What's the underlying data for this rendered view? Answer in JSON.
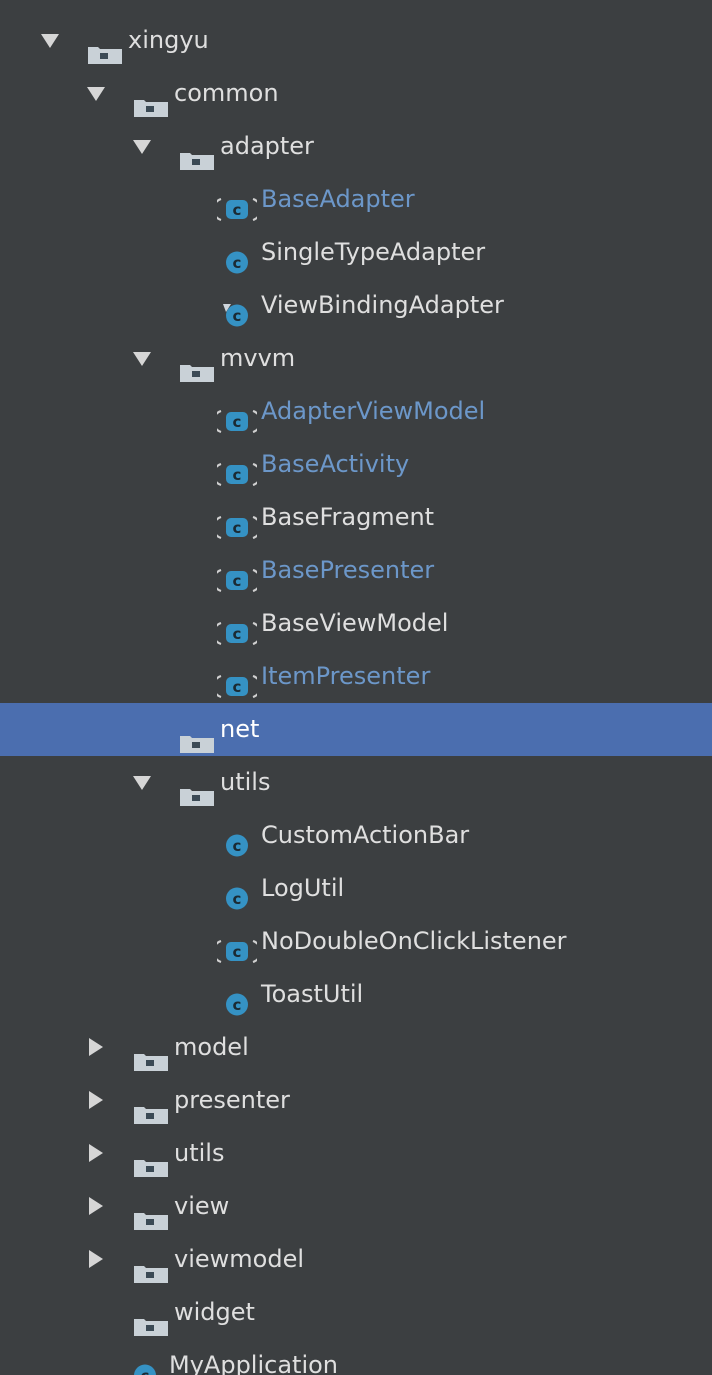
{
  "colors": {
    "background": "#3c3f41",
    "selected_row": "#4b6eaf",
    "text_normal": "#dfdfdf",
    "text_abstract": "#6c97c9",
    "class_icon": "#3592c4",
    "folder_icon": "#c9d1d7"
  },
  "tree": [
    {
      "label": "xingyu",
      "depth": 0,
      "arrow": "down",
      "icon": "folder-icon",
      "style": "normal",
      "slug": "xingyu"
    },
    {
      "label": "common",
      "depth": 1,
      "arrow": "down",
      "icon": "folder-icon",
      "style": "normal",
      "slug": "common"
    },
    {
      "label": "adapter",
      "depth": 2,
      "arrow": "down",
      "icon": "folder-icon",
      "style": "normal",
      "slug": "adapter"
    },
    {
      "label": "BaseAdapter",
      "depth": 3,
      "arrow": "none",
      "icon": "abstract-class-icon",
      "style": "blue",
      "slug": "base-adapter"
    },
    {
      "label": "SingleTypeAdapter",
      "depth": 3,
      "arrow": "none",
      "icon": "class-icon",
      "style": "normal",
      "slug": "single-type-adapter"
    },
    {
      "label": "ViewBindingAdapter",
      "depth": 3,
      "arrow": "none",
      "icon": "class-pinned-icon",
      "style": "normal",
      "slug": "view-binding-adapter"
    },
    {
      "label": "mvvm",
      "depth": 2,
      "arrow": "down",
      "icon": "folder-icon",
      "style": "normal",
      "slug": "mvvm"
    },
    {
      "label": "AdapterViewModel",
      "depth": 3,
      "arrow": "none",
      "icon": "abstract-class-icon",
      "style": "blue",
      "slug": "adapter-view-model"
    },
    {
      "label": "BaseActivity",
      "depth": 3,
      "arrow": "none",
      "icon": "abstract-class-icon",
      "style": "blue",
      "slug": "base-activity"
    },
    {
      "label": "BaseFragment",
      "depth": 3,
      "arrow": "none",
      "icon": "abstract-class-icon",
      "style": "normal",
      "slug": "base-fragment"
    },
    {
      "label": "BasePresenter",
      "depth": 3,
      "arrow": "none",
      "icon": "abstract-class-icon",
      "style": "blue",
      "slug": "base-presenter"
    },
    {
      "label": "BaseViewModel",
      "depth": 3,
      "arrow": "none",
      "icon": "abstract-class-icon",
      "style": "normal",
      "slug": "base-view-model"
    },
    {
      "label": "ItemPresenter",
      "depth": 3,
      "arrow": "none",
      "icon": "abstract-class-icon",
      "style": "blue",
      "slug": "item-presenter"
    },
    {
      "label": "net",
      "depth": 2,
      "arrow": "none",
      "icon": "folder-icon",
      "style": "normal",
      "slug": "net",
      "selected": true
    },
    {
      "label": "utils",
      "depth": 2,
      "arrow": "down",
      "icon": "folder-icon",
      "style": "normal",
      "slug": "common-utils"
    },
    {
      "label": "CustomActionBar",
      "depth": 3,
      "arrow": "none",
      "icon": "class-icon",
      "style": "normal",
      "slug": "custom-action-bar"
    },
    {
      "label": "LogUtil",
      "depth": 3,
      "arrow": "none",
      "icon": "class-icon",
      "style": "normal",
      "slug": "log-util"
    },
    {
      "label": "NoDoubleOnClickListener",
      "depth": 3,
      "arrow": "none",
      "icon": "abstract-class-icon",
      "style": "normal",
      "slug": "no-double-on-click-listener"
    },
    {
      "label": "ToastUtil",
      "depth": 3,
      "arrow": "none",
      "icon": "class-icon",
      "style": "normal",
      "slug": "toast-util"
    },
    {
      "label": "model",
      "depth": 1,
      "arrow": "right",
      "icon": "folder-icon",
      "style": "normal",
      "slug": "model"
    },
    {
      "label": "presenter",
      "depth": 1,
      "arrow": "right",
      "icon": "folder-icon",
      "style": "normal",
      "slug": "presenter"
    },
    {
      "label": "utils",
      "depth": 1,
      "arrow": "right",
      "icon": "folder-icon",
      "style": "normal",
      "slug": "utils"
    },
    {
      "label": "view",
      "depth": 1,
      "arrow": "right",
      "icon": "folder-icon",
      "style": "normal",
      "slug": "view"
    },
    {
      "label": "viewmodel",
      "depth": 1,
      "arrow": "right",
      "icon": "folder-icon",
      "style": "normal",
      "slug": "viewmodel"
    },
    {
      "label": "widget",
      "depth": 1,
      "arrow": "none",
      "icon": "folder-icon",
      "style": "normal",
      "slug": "widget"
    },
    {
      "label": "MyApplication",
      "depth": 1,
      "arrow": "none",
      "icon": "class-icon",
      "style": "normal",
      "slug": "my-application"
    }
  ]
}
